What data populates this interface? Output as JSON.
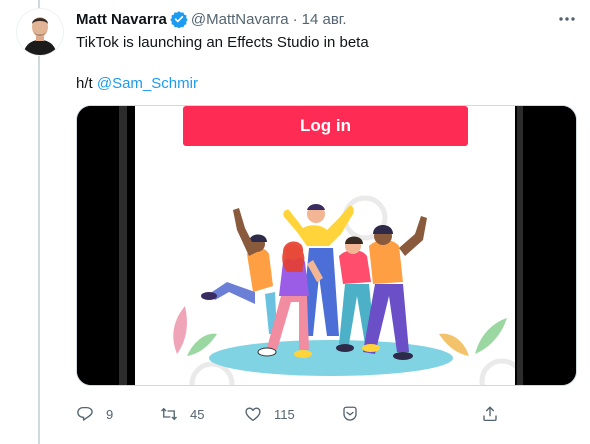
{
  "tweet": {
    "author_name": "Matt Navarra",
    "handle": "@MattNavarra",
    "separator": "·",
    "date": "14 авг.",
    "text": "TikTok is launching an Effects Studio in beta",
    "ht_prefix": "h/t",
    "mention": "@Sam_Schmir"
  },
  "media": {
    "button_label": "Log in",
    "watermark": "@"
  },
  "actions": {
    "replies": "9",
    "retweets": "45",
    "likes": "115"
  },
  "colors": {
    "accent": "#1d9bf0",
    "login_button": "#fe2c55",
    "text_secondary": "#536471"
  },
  "icons": [
    "verified-badge-icon",
    "more-icon",
    "reply-icon",
    "retweet-icon",
    "like-icon",
    "revue-icon",
    "share-icon"
  ]
}
